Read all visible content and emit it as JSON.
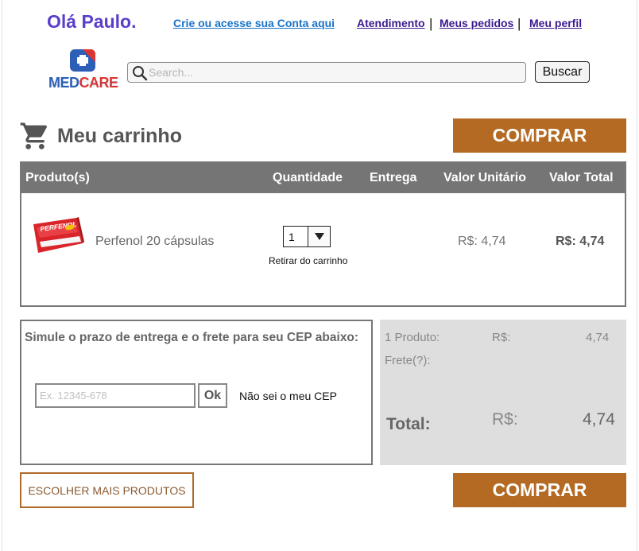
{
  "header": {
    "greeting": "Olá Paulo.",
    "account_link": "Crie ou acesse sua Conta aqui",
    "nav": [
      "Atendimento",
      "Meus pedidos",
      "Meu perfil"
    ],
    "separator": "|"
  },
  "logo": {
    "part1": "MED",
    "part2": "CARE",
    "icon": "medcare-cross-logo"
  },
  "search": {
    "placeholder": "Search...",
    "value": "",
    "button_label": "Buscar",
    "icon": "search-icon"
  },
  "cart": {
    "title": "Meu carrinho",
    "icon": "cart-icon",
    "buy_label": "COMPRAR",
    "columns": [
      "Produto(s)",
      "Quantidade",
      "Entrega",
      "Valor Unitário",
      "Valor Total"
    ],
    "items": [
      {
        "name": "Perfenol 20 cápsulas",
        "package_brand": "PERFENOL",
        "quantity": "1",
        "remove_label": "Retirar do carrinho",
        "unit_price": "R$: 4,74",
        "total_price": "R$: 4,74"
      }
    ]
  },
  "shipping": {
    "title": "Simule o prazo de entrega e o frete para seu CEP abaixo:",
    "cep_placeholder": "Ex. 12345-678",
    "ok_label": "Ok",
    "dont_know_label": "Não sei o meu CEP"
  },
  "summary": {
    "products_label": "1 Produto:",
    "products_currency": "R$:",
    "products_value": "4,74",
    "freight_label": "Frete(?):",
    "total_label": "Total:",
    "total_currency": "R$:",
    "total_value": "4,74"
  },
  "footer": {
    "more_products_label": "ESCOLHER MAIS PRODUTOS",
    "buy_label": "COMPRAR"
  },
  "colors": {
    "accent": "#b46a22",
    "header_bg": "#757575",
    "summary_bg": "#dedede",
    "greeting": "#5b3fc9"
  }
}
